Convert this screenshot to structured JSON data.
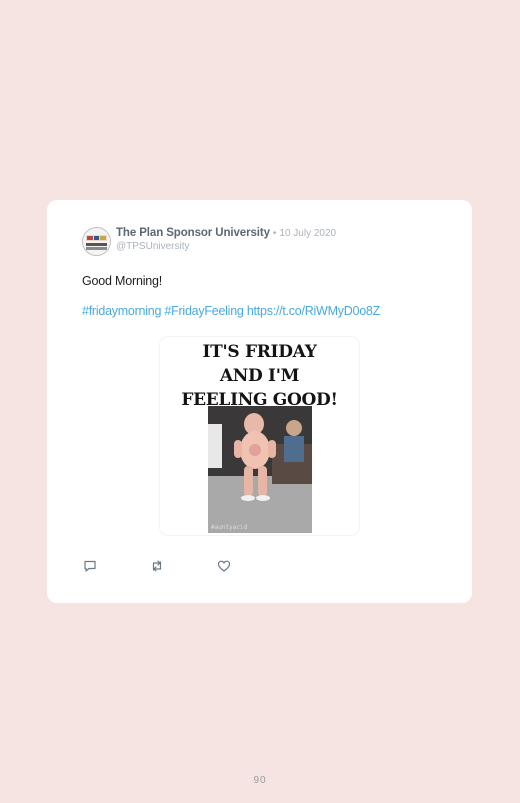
{
  "tweet": {
    "author_name": "The Plan Sponsor University",
    "separator": "•",
    "date": "10 July 2020",
    "handle": "@TPSUniversity",
    "text": "Good Morning!",
    "hashtags": [
      "#fridaymorning",
      "#FridayFeeling"
    ],
    "link": "https://t.co/RiWMyD0o8Z",
    "media": {
      "caption": "IT'S FRIDAY\nAND I'M\nFEELING GOOD!",
      "watermark": "#auntyacid"
    },
    "actions": [
      {
        "name": "reply-icon"
      },
      {
        "name": "retweet-icon"
      },
      {
        "name": "like-icon"
      }
    ]
  },
  "page_number": "90"
}
